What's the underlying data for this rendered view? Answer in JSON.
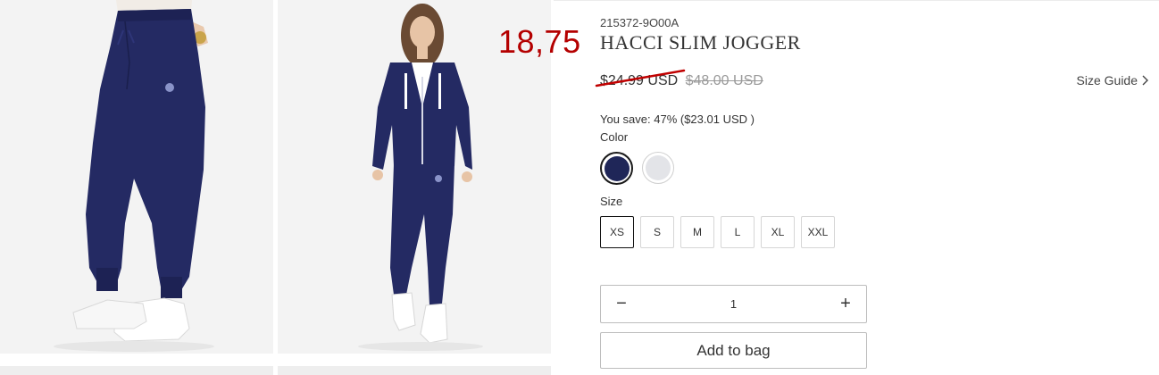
{
  "overlay_price": "18,75",
  "product": {
    "sku": "215372-9O00A",
    "title": "HACCI SLIM JOGGER",
    "price_current": "$24.99 USD",
    "price_original": "$48.00 USD",
    "savings": "You save: 47% ($23.01 USD )",
    "size_guide_label": "Size Guide"
  },
  "color": {
    "label": "Color",
    "swatches": [
      {
        "name": "Navy",
        "hex": "#1f2658",
        "selected": true
      },
      {
        "name": "Light Gray",
        "hex": "#e3e4e8",
        "selected": false
      }
    ]
  },
  "size": {
    "label": "Size",
    "options": [
      "XS",
      "S",
      "M",
      "L",
      "XL",
      "XXL"
    ],
    "selected": "XS"
  },
  "quantity": {
    "value": "1",
    "minus_symbol": "−",
    "plus_symbol": "+"
  },
  "add_to_bag_label": "Add to bag",
  "colors": {
    "navy": "#1f2658",
    "accent_red": "#b40000"
  }
}
